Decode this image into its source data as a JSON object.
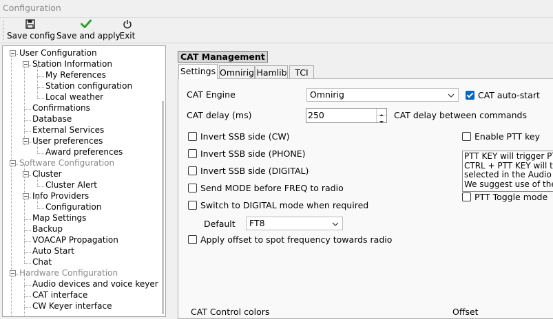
{
  "window": {
    "title": "Configuration"
  },
  "toolbar": {
    "save_config": "Save config",
    "save_and_apply": "Save and apply",
    "exit": "Exit"
  },
  "tree": [
    {
      "label": "User Configuration",
      "disabled": false
    },
    {
      "label": "Station Information",
      "disabled": false
    },
    {
      "label": "My References",
      "disabled": false
    },
    {
      "label": "Station configuration",
      "disabled": false
    },
    {
      "label": "Local weather",
      "disabled": false
    },
    {
      "label": "Confirmations",
      "disabled": false
    },
    {
      "label": "Database",
      "disabled": false
    },
    {
      "label": "External Services",
      "disabled": false
    },
    {
      "label": "User preferences",
      "disabled": false
    },
    {
      "label": "Award preferences",
      "disabled": false
    },
    {
      "label": "Software Configuration",
      "disabled": true
    },
    {
      "label": "Cluster",
      "disabled": false
    },
    {
      "label": "Cluster Alert",
      "disabled": false
    },
    {
      "label": "Info Providers",
      "disabled": false
    },
    {
      "label": "Configuration",
      "disabled": false
    },
    {
      "label": "Map Settings",
      "disabled": false
    },
    {
      "label": "Backup",
      "disabled": false
    },
    {
      "label": "VOACAP Propagation",
      "disabled": false
    },
    {
      "label": "Auto Start",
      "disabled": false
    },
    {
      "label": "Chat",
      "disabled": false
    },
    {
      "label": "Hardware Configuration",
      "disabled": true
    },
    {
      "label": "Audio devices and voice keyer",
      "disabled": false
    },
    {
      "label": "CAT interface",
      "disabled": false
    },
    {
      "label": "CW Keyer interface",
      "disabled": false
    }
  ],
  "cat": {
    "group_title": "CAT Management",
    "tabs": [
      "Settings",
      "Omnirig",
      "Hamlib",
      "TCI"
    ],
    "active_tab": "Settings",
    "engine_label": "CAT Engine",
    "engine_value": "Omnirig",
    "autostart_label": "CAT auto-start",
    "autostart_checked": true,
    "delay_label": "CAT delay (ms)",
    "delay_value": "250",
    "delay_desc": "CAT delay between commands",
    "options": [
      {
        "label": "Invert SSB side (CW)",
        "checked": false
      },
      {
        "label": "Invert SSB side (PHONE)",
        "checked": false
      },
      {
        "label": "Invert SSB side (DIGITAL)",
        "checked": false
      },
      {
        "label": "Send MODE before FREQ to radio",
        "checked": false
      },
      {
        "label": "Switch to DIGITAL mode when required",
        "checked": false
      }
    ],
    "default_label": "Default",
    "default_value": "FT8",
    "apply_offset_label": "Apply offset to spot frequency towards radio",
    "enable_ptt_label": "Enable PTT key",
    "ptt_info_lines": [
      "PTT KEY will trigger PT",
      "CTRL + PTT KEY will tri",
      "selected in the Audio C",
      "We suggest use of the"
    ],
    "ptt_toggle_label": "PTT Toggle mode",
    "control_colors_label": "CAT Control colors",
    "offset_label": "Offset",
    "accent_color": "#0067c0"
  }
}
